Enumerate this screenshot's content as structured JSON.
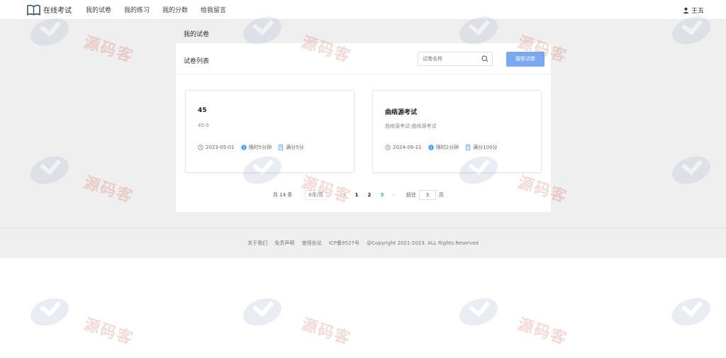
{
  "header": {
    "app_title": "在线考试",
    "nav": [
      "我的试卷",
      "我的练习",
      "我的分数",
      "给我留言"
    ],
    "user_name": "王五"
  },
  "breadcrumb": "我的试卷",
  "panel": {
    "title": "试卷列表",
    "search_placeholder": "试卷名称",
    "search_button": "搜索试卷"
  },
  "cards": [
    {
      "title": "45",
      "desc": "45-5",
      "date": "2023-05-01",
      "time_limit": "限时5分钟",
      "full_score": "满分5分"
    },
    {
      "title": "曲络源考试",
      "desc": "曲络源考试-曲络源考试",
      "date": "2024-09-21",
      "time_limit": "限时2分钟",
      "full_score": "满分100分"
    }
  ],
  "pagination": {
    "total": "共 14 条",
    "page_size": "6条/页",
    "pages": [
      "1",
      "2",
      "3"
    ],
    "current_page": "3",
    "goto_label": "前往",
    "goto_value": "3",
    "page_unit": "页"
  },
  "footer": {
    "links": [
      "关于我们",
      "免责声明",
      "使用协议",
      "ICP备9527号"
    ],
    "copyright": "@Copyright 2021-2023. ALL Rights Reserved"
  },
  "watermark": {
    "text": "源码客"
  },
  "colors": {
    "primary": "#409eff",
    "search_button": "#79a9f3",
    "gray_bg": "#efefef"
  }
}
